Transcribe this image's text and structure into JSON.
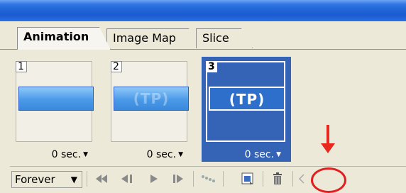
{
  "tabs": [
    {
      "label": "Animation",
      "active": true
    },
    {
      "label": "Image Map",
      "active": false
    },
    {
      "label": "Slice",
      "active": false
    }
  ],
  "frames": [
    {
      "number": "1",
      "delay": "0 sec.",
      "selected": false,
      "banner_text": ""
    },
    {
      "number": "2",
      "delay": "0 sec.",
      "selected": false,
      "banner_text": "(TP)"
    },
    {
      "number": "3",
      "delay": "0 sec.",
      "selected": true,
      "banner_text": "(TP)"
    }
  ],
  "toolbar": {
    "loop_value": "Forever",
    "buttons": [
      "first-frame-icon",
      "previous-frame-icon",
      "play-icon",
      "next-frame-icon",
      "tween-icon",
      "duplicate-frame-icon",
      "trash-icon",
      "scroll-left-icon"
    ]
  },
  "colors": {
    "title_blue": "#2468d8",
    "selected_frame": "#3563b5",
    "annotation_red": "#e02020",
    "panel_bg": "#ece9d8"
  }
}
